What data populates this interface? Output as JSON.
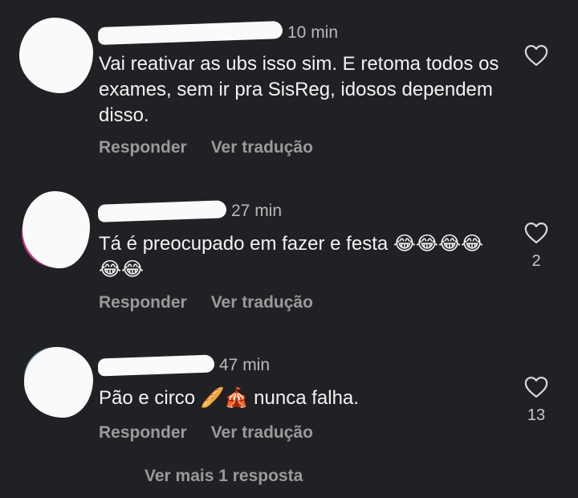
{
  "comments": [
    {
      "time": "10 min",
      "text": "Vai reativar as ubs isso sim. E retoma todos os exames, sem ir pra SisReg, idosos dependem disso.",
      "reply_label": "Responder",
      "translate_label": "Ver tradução",
      "likes": ""
    },
    {
      "time": "27 min",
      "text": "Tá é preocupado em fazer e festa 😂😂😂😂😂😂",
      "reply_label": "Responder",
      "translate_label": "Ver tradução",
      "likes": "2"
    },
    {
      "time": "47 min",
      "text": "Pão e circo 🥖🎪 nunca falha.",
      "reply_label": "Responder",
      "translate_label": "Ver tradução",
      "likes": "13"
    }
  ],
  "view_more_replies": "Ver mais 1 resposta",
  "icons": {
    "like": "heart-outline-icon"
  }
}
